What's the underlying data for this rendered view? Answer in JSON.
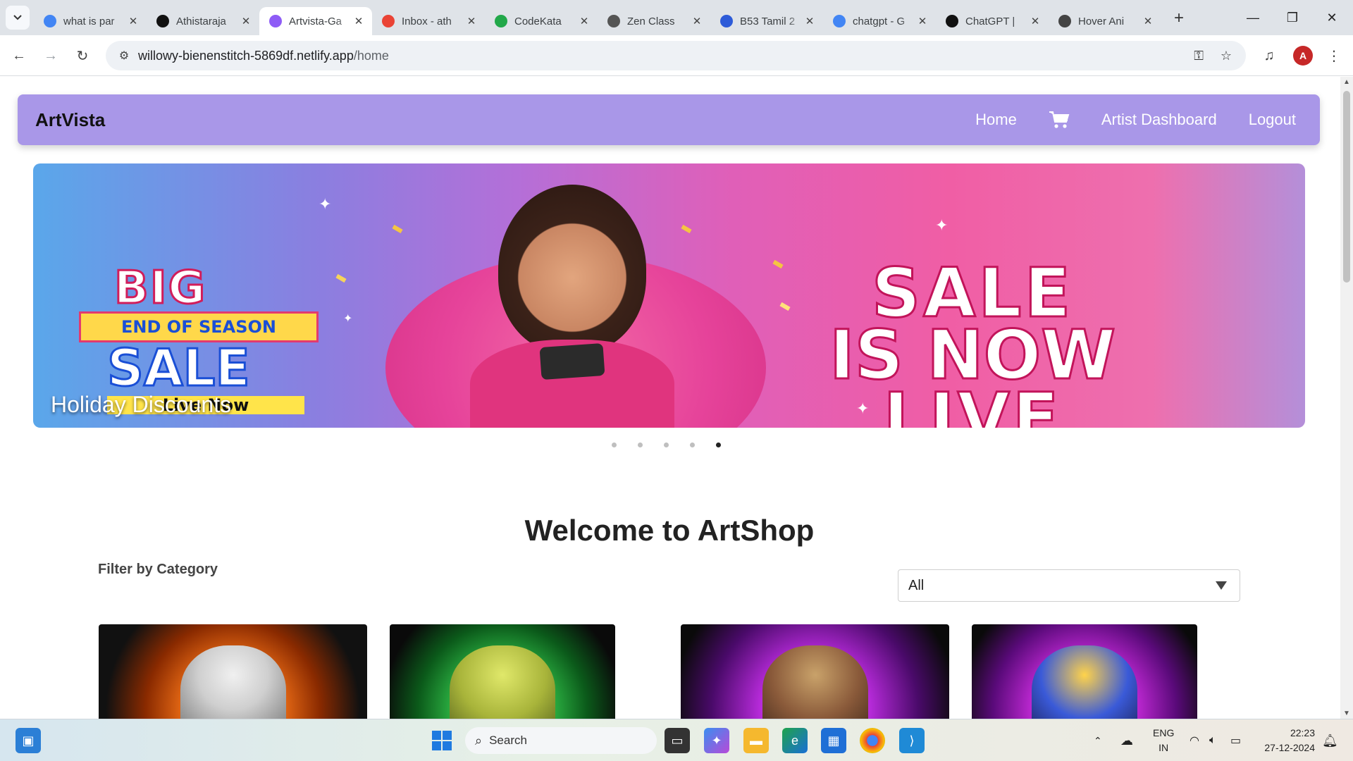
{
  "browser": {
    "tabs": [
      {
        "title": "what is par",
        "favicon": "google-icon",
        "color": "#4285f4"
      },
      {
        "title": "Athistaraja",
        "favicon": "github-icon",
        "color": "#111111"
      },
      {
        "title": "Artvista-Ga",
        "favicon": "vite-icon",
        "color": "#8e5cf6",
        "active": true
      },
      {
        "title": "Inbox - ath",
        "favicon": "gmail-icon",
        "color": "#ea4335"
      },
      {
        "title": "CodeKata",
        "favicon": "codekata-icon",
        "color": "#22a84a"
      },
      {
        "title": "Zen Class",
        "favicon": "zen-icon",
        "color": "#555555"
      },
      {
        "title": "B53 Tamil 2",
        "favicon": "zoom-icon",
        "color": "#2d5bd8"
      },
      {
        "title": "chatgpt - G",
        "favicon": "google-icon",
        "color": "#4285f4"
      },
      {
        "title": "ChatGPT |",
        "favicon": "openai-icon",
        "color": "#111111"
      },
      {
        "title": "Hover Ani",
        "favicon": "openai-icon",
        "color": "#444444"
      }
    ],
    "url_host": "willowy-bienenstitch-5869df.netlify.app",
    "url_path": "/home"
  },
  "navbar": {
    "brand": "ArtVista",
    "links": [
      "Home",
      "Artist Dashboard",
      "Logout"
    ]
  },
  "carousel": {
    "caption": "Holiday Discounts",
    "banner_left": {
      "big": "BIG",
      "band": "END OF SEASON",
      "sale": "SALE",
      "live": "Live Now"
    },
    "banner_right": {
      "line1": "SALE",
      "line2": "IS NOW",
      "line3": "LIVE"
    },
    "slide_count": 5,
    "active_index": 4
  },
  "main": {
    "heading": "Welcome to ArtShop",
    "filter_label": "Filter by Category",
    "filter_value": "All"
  },
  "taskbar": {
    "search_placeholder": "Search",
    "lang_line1": "ENG",
    "lang_line2": "IN",
    "time": "22:23",
    "date": "27-12-2024"
  },
  "colors": {
    "navbar": "#a997e8",
    "accent": "#8e5cf6"
  }
}
